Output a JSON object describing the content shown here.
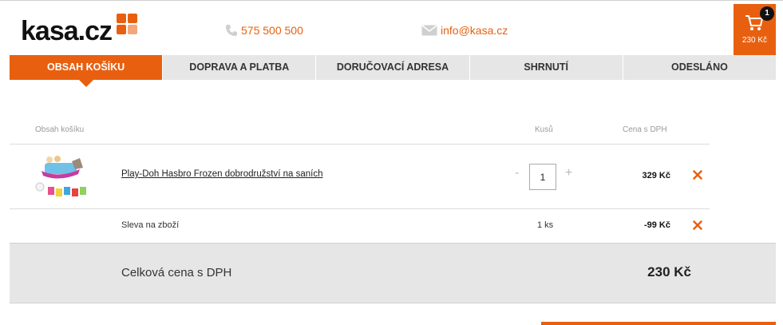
{
  "brand": {
    "logo_text": "kasa.cz",
    "accent_color": "#e8600f"
  },
  "contact": {
    "phone": "575 500 500",
    "phone_icon": "phone-icon",
    "email": "info@kasa.cz",
    "email_icon": "envelope-icon"
  },
  "cart": {
    "icon": "cart-icon",
    "count": "1",
    "total": "230 Kč"
  },
  "steps": [
    {
      "label": "OBSAH KOŠÍKU",
      "active": true
    },
    {
      "label": "DOPRAVA A PLATBA",
      "active": false
    },
    {
      "label": "DORUČOVACÍ ADRESA",
      "active": false
    },
    {
      "label": "SHRNUTÍ",
      "active": false
    },
    {
      "label": "ODESLÁNO",
      "active": false
    }
  ],
  "table": {
    "headers": {
      "content": "Obsah košíku",
      "qty": "Kusů",
      "price": "Cena s DPH"
    },
    "items": [
      {
        "name": "Play-Doh Hasbro Frozen dobrodružství na saních",
        "qty_minus": "-",
        "qty": "1",
        "qty_plus": "+",
        "price": "329 Kč",
        "remove_icon": "close-icon"
      }
    ],
    "discount": {
      "label": "Sleva na zboží",
      "qty": "1 ks",
      "price": "-99 Kč",
      "remove_icon": "close-icon"
    },
    "total": {
      "label": "Celková cena s DPH",
      "value": "230 Kč"
    }
  }
}
